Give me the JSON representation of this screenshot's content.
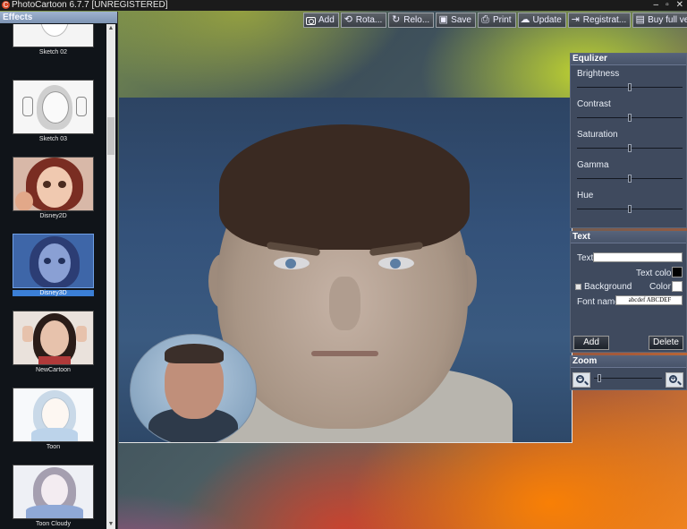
{
  "window": {
    "title": "PhotoCartoon 6.7.7 [UNREGISTERED]",
    "app_icon": "app-logo-icon"
  },
  "toolbar": [
    {
      "label": "Add",
      "icon": "camera-icon"
    },
    {
      "label": "Rota...",
      "icon": "rotate-icon"
    },
    {
      "label": "Relo...",
      "icon": "reload-icon"
    },
    {
      "label": "Save",
      "icon": "save-icon"
    },
    {
      "label": "Print",
      "icon": "print-icon"
    },
    {
      "label": "Update",
      "icon": "cloud-download-icon"
    },
    {
      "label": "Registrat...",
      "icon": "register-icon"
    },
    {
      "label": "Buy full ver...",
      "icon": "cart-icon"
    }
  ],
  "effects": {
    "header": "Effects",
    "items": [
      {
        "label": "Sketch 02",
        "selected": false
      },
      {
        "label": "Sketch 03",
        "selected": false
      },
      {
        "label": "Disney2D",
        "selected": false
      },
      {
        "label": "Disney3D",
        "selected": true
      },
      {
        "label": "NewCartoon",
        "selected": false
      },
      {
        "label": "Toon",
        "selected": false
      },
      {
        "label": "Toon Cloudy",
        "selected": false
      }
    ]
  },
  "equalizer": {
    "header": "Equlizer",
    "sliders": [
      {
        "label": "Brightness",
        "value": 0.5
      },
      {
        "label": "Contrast",
        "value": 0.5
      },
      {
        "label": "Saturation",
        "value": 0.5
      },
      {
        "label": "Gamma",
        "value": 0.5
      },
      {
        "label": "Hue",
        "value": 0.5
      }
    ]
  },
  "text_panel": {
    "header": "Text",
    "text_label": "Text",
    "text_value": "",
    "text_color_label": "Text color",
    "text_color": "#000000",
    "background_label": "Background",
    "background_checked": false,
    "color_label": "Color",
    "background_color": "#ffffff",
    "font_name_label": "Font name",
    "font_preview": "abcdef ABCDEF",
    "add_button": "Add",
    "delete_button": "Delete"
  },
  "zoom": {
    "header": "Zoom",
    "level": 0.05,
    "zoom_out_icon": "zoom-out-icon",
    "zoom_in_icon": "zoom-in-icon"
  }
}
